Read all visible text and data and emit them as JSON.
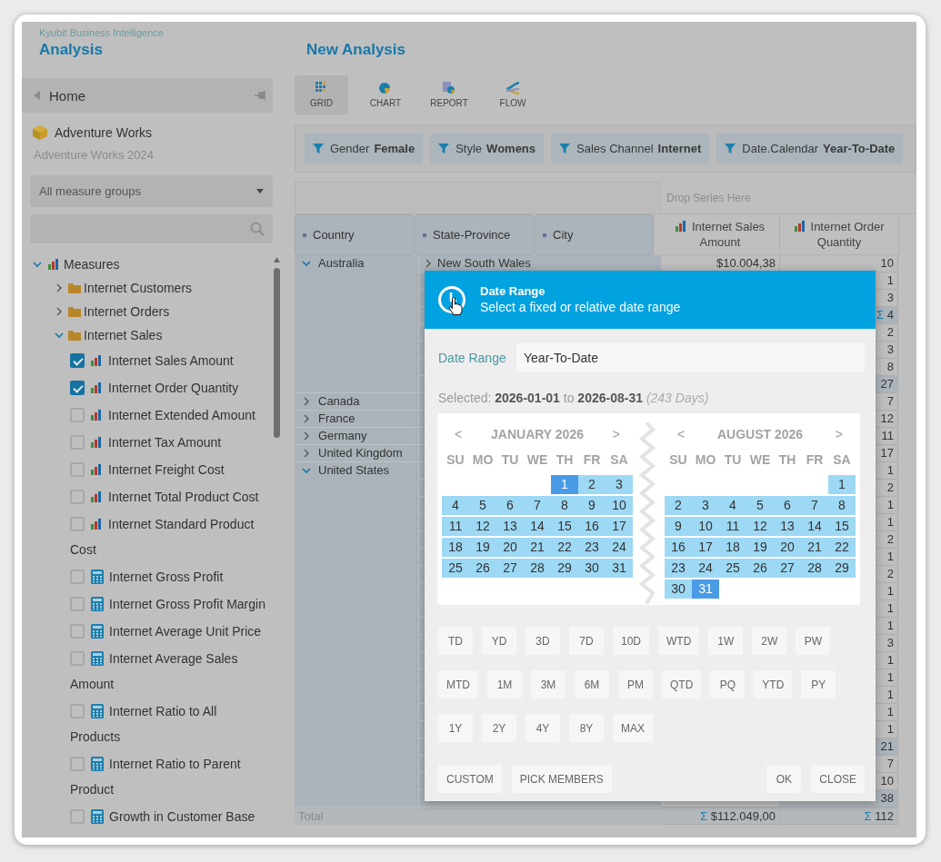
{
  "app": {
    "brand": "Kyubit Business Intelligence",
    "section": "Analysis"
  },
  "sidebar": {
    "home": "Home",
    "cube": "Adventure Works",
    "database": "Adventure Works 2024",
    "measure_group": "All measure groups",
    "tree": [
      {
        "label": "Measures",
        "kind": "root",
        "expanded": true,
        "children": [
          {
            "label": "Internet Customers",
            "kind": "folder",
            "expanded": false
          },
          {
            "label": "Internet Orders",
            "kind": "folder",
            "expanded": false
          },
          {
            "label": "Internet Sales",
            "kind": "folder",
            "expanded": true,
            "children": [
              {
                "label": "Internet Sales Amount",
                "kind": "measure",
                "checked": true
              },
              {
                "label": "Internet Order Quantity",
                "kind": "measure",
                "checked": true
              },
              {
                "label": "Internet Extended Amount",
                "kind": "measure",
                "checked": false
              },
              {
                "label": "Internet Tax Amount",
                "kind": "measure",
                "checked": false
              },
              {
                "label": "Internet Freight Cost",
                "kind": "measure",
                "checked": false
              },
              {
                "label": "Internet Total Product Cost",
                "kind": "measure",
                "checked": false
              },
              {
                "label": "Internet Standard Product Cost",
                "kind": "measure",
                "checked": false
              },
              {
                "label": "Internet Gross Profit",
                "kind": "calculated",
                "checked": false
              },
              {
                "label": "Internet Gross Profit Margin",
                "kind": "calculated",
                "checked": false
              },
              {
                "label": "Internet Average Unit Price",
                "kind": "calculated",
                "checked": false
              },
              {
                "label": "Internet Average Sales Amount",
                "kind": "calculated",
                "checked": false
              },
              {
                "label": "Internet Ratio to All Products",
                "kind": "calculated",
                "checked": false
              },
              {
                "label": "Internet Ratio to Parent Product",
                "kind": "calculated",
                "checked": false
              },
              {
                "label": "Growth in Customer Base",
                "kind": "calculated",
                "checked": false
              }
            ]
          }
        ]
      }
    ]
  },
  "main": {
    "title": "New Analysis",
    "views": [
      {
        "label": "GRID",
        "kind": "grid",
        "selected": true
      },
      {
        "label": "CHART",
        "kind": "chart",
        "selected": false
      },
      {
        "label": "REPORT",
        "kind": "report",
        "selected": false
      },
      {
        "label": "FLOW",
        "kind": "flow",
        "selected": false
      }
    ],
    "filters": [
      {
        "field": "Gender",
        "value": "Female"
      },
      {
        "field": "Style",
        "value": "Womens"
      },
      {
        "field": "Sales Channel",
        "value": "Internet"
      },
      {
        "field": "Date.Calendar",
        "value": "Year-To-Date"
      }
    ],
    "grid": {
      "drop_hint": "Drop Series Here",
      "row_headers": [
        "Country",
        "State-Province",
        "City"
      ],
      "measures": [
        "Internet Sales Amount",
        "Internet Order Quantity"
      ],
      "groups": [
        {
          "country": "Australia",
          "expanded": true,
          "rows": [
            {
              "state": "New South Wales",
              "state_expanded": false,
              "amount": "$10.004,38",
              "quantity": "10",
              "kind": "value"
            },
            {
              "quantity": "1",
              "kind": "value"
            },
            {
              "quantity": "3",
              "kind": "value"
            },
            {
              "sigma": "Σ",
              "quantity": "4",
              "kind": "subtotal"
            },
            {
              "quantity": "2",
              "kind": "value"
            },
            {
              "quantity": "3",
              "kind": "value"
            },
            {
              "quantity": "8",
              "kind": "value"
            },
            {
              "quantity": "27",
              "kind": "subtotal"
            }
          ]
        },
        {
          "country": "Canada",
          "expanded": false,
          "rows": [
            {
              "quantity": "7",
              "kind": "value"
            }
          ]
        },
        {
          "country": "France",
          "expanded": false,
          "rows": [
            {
              "quantity": "12",
              "kind": "value"
            }
          ]
        },
        {
          "country": "Germany",
          "expanded": false,
          "rows": [
            {
              "quantity": "11",
              "kind": "value"
            }
          ]
        },
        {
          "country": "United Kingdom",
          "expanded": false,
          "rows": [
            {
              "quantity": "17",
              "kind": "value"
            }
          ]
        },
        {
          "country": "United States",
          "expanded": true,
          "rows": [
            {
              "quantity": "1",
              "kind": "value"
            },
            {
              "quantity": "2",
              "kind": "value"
            },
            {
              "quantity": "1",
              "kind": "value"
            },
            {
              "quantity": "1",
              "kind": "value"
            },
            {
              "quantity": "2",
              "kind": "value"
            },
            {
              "quantity": "1",
              "kind": "value"
            },
            {
              "quantity": "2",
              "kind": "value"
            },
            {
              "quantity": "1",
              "kind": "value"
            },
            {
              "quantity": "1",
              "kind": "value"
            },
            {
              "quantity": "1",
              "kind": "value"
            },
            {
              "quantity": "3",
              "kind": "value"
            },
            {
              "quantity": "1",
              "kind": "value"
            },
            {
              "quantity": "1",
              "kind": "value"
            },
            {
              "quantity": "1",
              "kind": "value"
            },
            {
              "quantity": "1",
              "kind": "value"
            },
            {
              "quantity": "1",
              "kind": "value"
            },
            {
              "quantity": "21",
              "kind": "subtotal"
            },
            {
              "quantity": "7",
              "kind": "value"
            },
            {
              "quantity": "10",
              "kind": "value"
            },
            {
              "quantity": "38",
              "kind": "subtotal"
            }
          ]
        }
      ],
      "total": {
        "label": "Total",
        "amount_sigma": "Σ",
        "amount": "$112.049,00",
        "quantity_sigma": "Σ",
        "quantity": "112"
      }
    }
  },
  "dialog": {
    "title": "Date Range",
    "subtitle": "Select a fixed or relative date range",
    "field_label": "Date Range",
    "field_value": "Year-To-Date",
    "selection": "Selected: **2026-01-01** to **2026-08-31** *(243 Days)*",
    "months": [
      {
        "prev": "<",
        "title": "JANUARY 2026",
        "next": ">",
        "weekdays": [
          "SU",
          "MO",
          "TU",
          "WE",
          "TH",
          "FR",
          "SA"
        ],
        "days": [
          {
            "kind": "blank"
          },
          {
            "kind": "blank"
          },
          {
            "kind": "blank"
          },
          {
            "kind": "blank"
          },
          {
            "label": "1",
            "kind": "endpoint"
          },
          {
            "label": "2",
            "kind": "in_range"
          },
          {
            "label": "3",
            "kind": "in_range"
          },
          {
            "label": "4",
            "kind": "in_range"
          },
          {
            "label": "5",
            "kind": "in_range"
          },
          {
            "label": "6",
            "kind": "in_range"
          },
          {
            "label": "7",
            "kind": "in_range"
          },
          {
            "label": "8",
            "kind": "in_range"
          },
          {
            "label": "9",
            "kind": "in_range"
          },
          {
            "label": "10",
            "kind": "in_range"
          },
          {
            "label": "11",
            "kind": "in_range"
          },
          {
            "label": "12",
            "kind": "in_range"
          },
          {
            "label": "13",
            "kind": "in_range"
          },
          {
            "label": "14",
            "kind": "in_range"
          },
          {
            "label": "15",
            "kind": "in_range"
          },
          {
            "label": "16",
            "kind": "in_range"
          },
          {
            "label": "17",
            "kind": "in_range"
          },
          {
            "label": "18",
            "kind": "in_range"
          },
          {
            "label": "19",
            "kind": "in_range"
          },
          {
            "label": "20",
            "kind": "in_range"
          },
          {
            "label": "21",
            "kind": "in_range"
          },
          {
            "label": "22",
            "kind": "in_range"
          },
          {
            "label": "23",
            "kind": "in_range"
          },
          {
            "label": "24",
            "kind": "in_range"
          },
          {
            "label": "25",
            "kind": "in_range"
          },
          {
            "label": "26",
            "kind": "in_range"
          },
          {
            "label": "27",
            "kind": "in_range"
          },
          {
            "label": "28",
            "kind": "in_range"
          },
          {
            "label": "29",
            "kind": "in_range"
          },
          {
            "label": "30",
            "kind": "in_range"
          },
          {
            "label": "31",
            "kind": "in_range"
          }
        ]
      },
      {
        "prev": "<",
        "title": "AUGUST 2026",
        "next": ">",
        "weekdays": [
          "SU",
          "MO",
          "TU",
          "WE",
          "TH",
          "FR",
          "SA"
        ],
        "days": [
          {
            "kind": "blank"
          },
          {
            "kind": "blank"
          },
          {
            "kind": "blank"
          },
          {
            "kind": "blank"
          },
          {
            "kind": "blank"
          },
          {
            "kind": "blank"
          },
          {
            "label": "1",
            "kind": "in_range"
          },
          {
            "label": "2",
            "kind": "in_range"
          },
          {
            "label": "3",
            "kind": "in_range"
          },
          {
            "label": "4",
            "kind": "in_range"
          },
          {
            "label": "5",
            "kind": "in_range"
          },
          {
            "label": "6",
            "kind": "in_range"
          },
          {
            "label": "7",
            "kind": "in_range"
          },
          {
            "label": "8",
            "kind": "in_range"
          },
          {
            "label": "9",
            "kind": "in_range"
          },
          {
            "label": "10",
            "kind": "in_range"
          },
          {
            "label": "11",
            "kind": "in_range"
          },
          {
            "label": "12",
            "kind": "in_range"
          },
          {
            "label": "13",
            "kind": "in_range"
          },
          {
            "label": "14",
            "kind": "in_range"
          },
          {
            "label": "15",
            "kind": "in_range"
          },
          {
            "label": "16",
            "kind": "in_range"
          },
          {
            "label": "17",
            "kind": "in_range"
          },
          {
            "label": "18",
            "kind": "in_range"
          },
          {
            "label": "19",
            "kind": "in_range"
          },
          {
            "label": "20",
            "kind": "in_range"
          },
          {
            "label": "21",
            "kind": "in_range"
          },
          {
            "label": "22",
            "kind": "in_range"
          },
          {
            "label": "23",
            "kind": "in_range"
          },
          {
            "label": "24",
            "kind": "in_range"
          },
          {
            "label": "25",
            "kind": "in_range"
          },
          {
            "label": "26",
            "kind": "in_range"
          },
          {
            "label": "27",
            "kind": "in_range"
          },
          {
            "label": "28",
            "kind": "in_range"
          },
          {
            "label": "29",
            "kind": "in_range"
          },
          {
            "label": "30",
            "kind": "in_range"
          },
          {
            "label": "31",
            "kind": "endpoint"
          }
        ]
      }
    ],
    "presets": [
      [
        "TD",
        "YD",
        "3D",
        "7D",
        "10D",
        "WTD",
        "1W",
        "2W",
        "PW"
      ],
      [
        "MTD",
        "1M",
        "3M",
        "6M",
        "PM",
        "QTD",
        "PQ",
        "YTD",
        "PY"
      ],
      [
        "1Y",
        "2Y",
        "4Y",
        "8Y",
        "MAX"
      ]
    ],
    "actions_left": [
      "CUSTOM",
      "PICK MEMBERS"
    ],
    "actions_right": [
      "OK",
      "CLOSE"
    ]
  }
}
